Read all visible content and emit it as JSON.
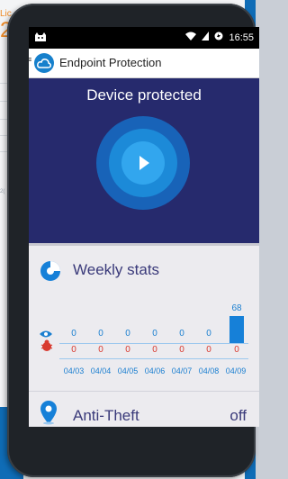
{
  "background": {
    "top_text": "Lic",
    "big_number": "2",
    "side_small": "2("
  },
  "status_bar": {
    "left_icon": "notification-icon",
    "time": "16:55"
  },
  "app": {
    "title": "Endpoint Protection"
  },
  "hero": {
    "status": "Device protected"
  },
  "weekly_stats": {
    "title": "Weekly stats",
    "dates": [
      "04/03",
      "04/04",
      "04/05",
      "04/06",
      "04/07",
      "04/08",
      "04/09"
    ],
    "scanned": [
      0,
      0,
      0,
      0,
      0,
      0,
      68
    ],
    "threats": [
      0,
      0,
      0,
      0,
      0,
      0,
      0
    ],
    "bar_label": "68"
  },
  "anti_theft": {
    "title": "Anti-Theft",
    "status": "off"
  },
  "colors": {
    "hero_bg": "#262a6d",
    "accent": "#1680d8",
    "threat": "#d83a2f"
  }
}
